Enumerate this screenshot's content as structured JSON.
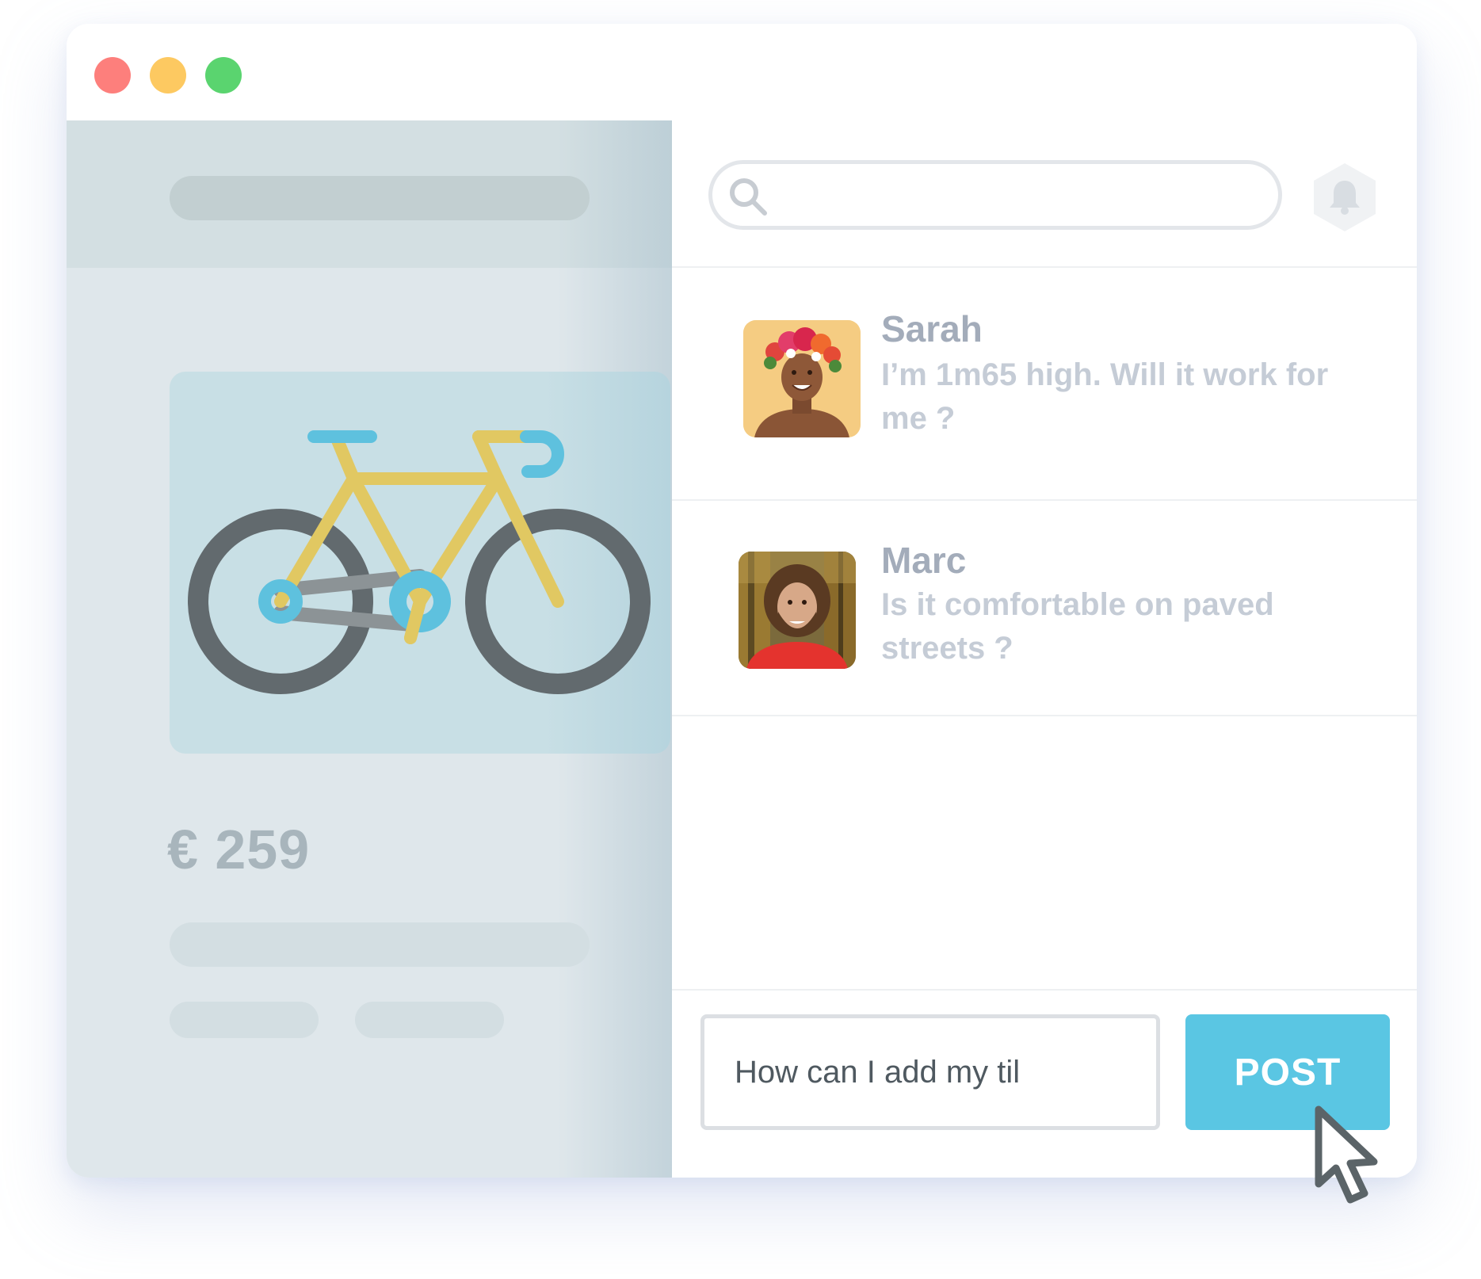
{
  "window": {
    "controls": {
      "close_color": "#fd7f7c",
      "minimize_color": "#fdc961",
      "maximize_color": "#5ad46f"
    }
  },
  "product": {
    "price": "€ 259",
    "image_icon": "bicycle-icon",
    "colors": {
      "frame": "#e1c862",
      "wheels": "#626a6e",
      "accent": "#5ec1de",
      "chain": "#8c9396",
      "price_text": "#a8b5bc"
    }
  },
  "search": {
    "value": "",
    "placeholder": "",
    "icon": "search-icon"
  },
  "notifications": {
    "icon": "bell-icon",
    "badge_color": "#f0f2f4",
    "bell_color": "#d8dde2"
  },
  "comments": [
    {
      "name": "Sarah",
      "text": "I’m 1m65 high. Will it work for me ?",
      "avatar": "avatar-sarah"
    },
    {
      "name": "Marc",
      "text": "Is it comfortable on paved streets ?",
      "avatar": "avatar-marc"
    }
  ],
  "composer": {
    "value": "How can I add my til",
    "post_label": "POST"
  },
  "colors": {
    "accent": "#5ac6e3",
    "name_text": "#a3acba",
    "comment_text": "#c5ccd6",
    "input_text": "#4f5960",
    "divider": "#eef0f2",
    "skeleton_dark": "#c2cfd1",
    "skeleton_light": "#d3dee2"
  }
}
